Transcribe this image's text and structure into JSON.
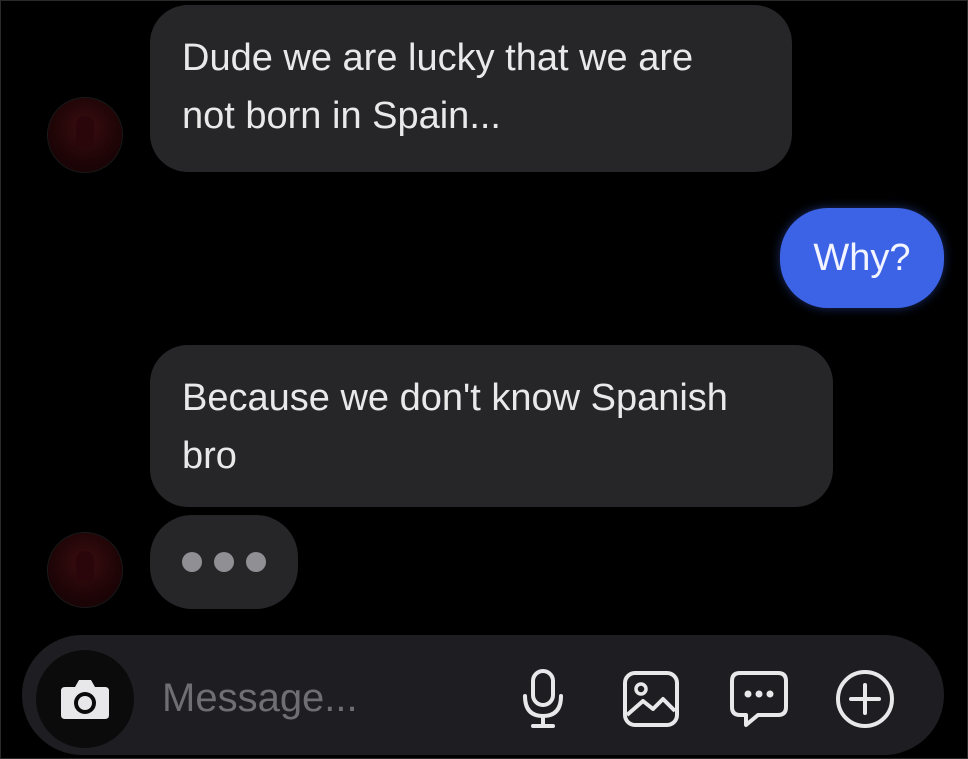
{
  "conversation": {
    "messages": [
      {
        "sender": "other",
        "lines": [
          "Dude we are lucky that we are",
          "not born in Spain..."
        ]
      },
      {
        "sender": "me",
        "lines": [
          "Why?"
        ]
      },
      {
        "sender": "other",
        "lines": [
          "Because we don't know Spanish",
          "bro"
        ]
      }
    ],
    "typing_indicator": true
  },
  "composer": {
    "placeholder": "Message..."
  },
  "icons": {
    "camera": "camera-icon",
    "microphone": "microphone-icon",
    "gallery": "image-icon",
    "sticker": "chat-bubble-icon",
    "more": "plus-icon"
  },
  "colors": {
    "background": "#000000",
    "incoming_bubble": "#262528",
    "outgoing_bubble": "#3c63e6",
    "text": "#e9e9ea",
    "placeholder": "#6e6e73"
  }
}
